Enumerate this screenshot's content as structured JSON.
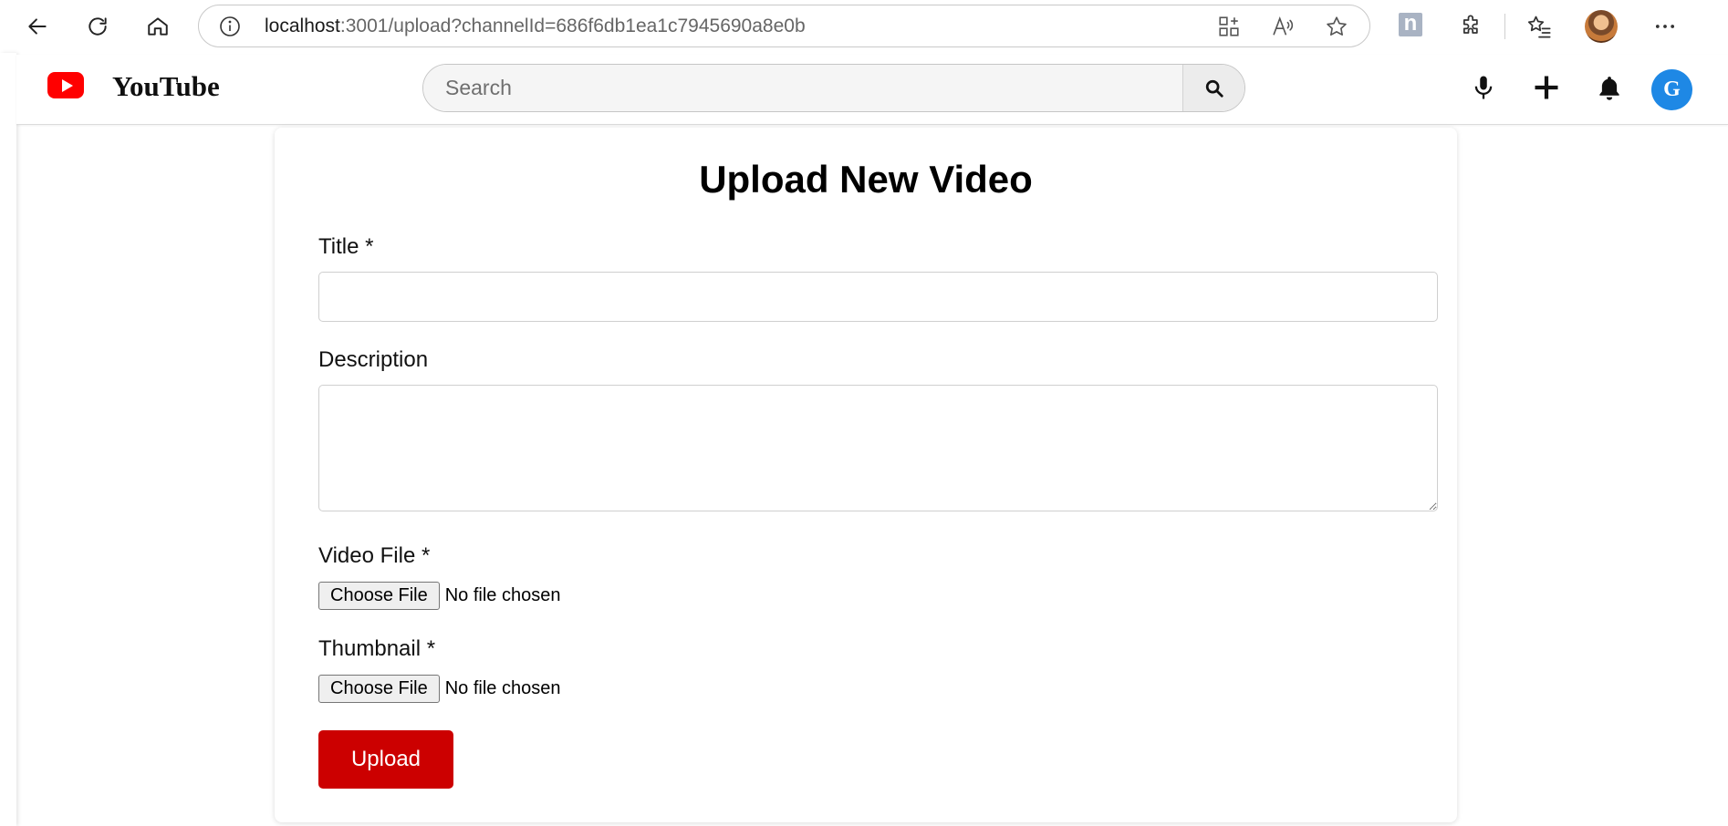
{
  "browser": {
    "url_host": "localhost",
    "url_rest": ":3001/upload?channelId=686f6db1ea1c7945690a8e0b",
    "extension_label": "n"
  },
  "header": {
    "brand": "YouTube",
    "search_placeholder": "Search",
    "avatar_initial": "G",
    "brand_color": "#ff0000",
    "avatar_color": "#1e88e5"
  },
  "form": {
    "heading": "Upload New Video",
    "title_label": "Title *",
    "title_value": "",
    "description_label": "Description",
    "description_value": "",
    "video_label": "Video File *",
    "video_button": "Choose File",
    "video_status": "No file chosen",
    "thumbnail_label": "Thumbnail *",
    "thumbnail_button": "Choose File",
    "thumbnail_status": "No file chosen",
    "submit_label": "Upload",
    "submit_color": "#cc0000"
  }
}
